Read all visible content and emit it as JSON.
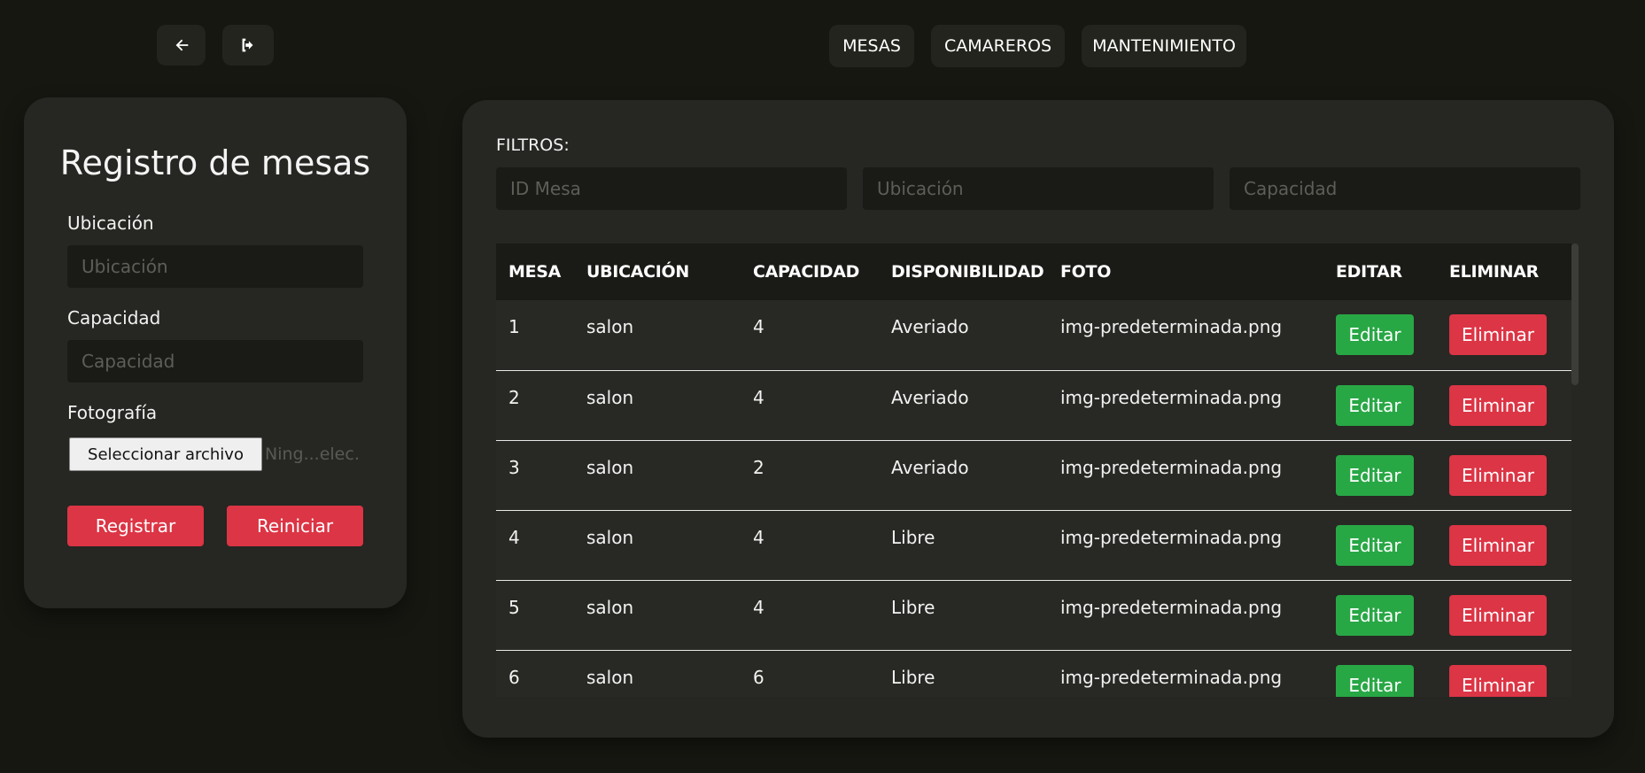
{
  "toolbar": {
    "back_icon": "arrow-left-icon",
    "logout_icon": "sign-out-icon"
  },
  "nav": {
    "items": [
      "MESAS",
      "CAMAREROS",
      "MANTENIMIENTO"
    ]
  },
  "form": {
    "title": "Registro de mesas",
    "ubicacion_label": "Ubicación",
    "ubicacion_placeholder": "Ubicación",
    "capacidad_label": "Capacidad",
    "capacidad_placeholder": "Capacidad",
    "foto_label": "Fotografía",
    "file_button": "Seleccionar archivo",
    "file_status": "Ning...elec.",
    "submit_label": "Registrar",
    "reset_label": "Reiniciar"
  },
  "filters": {
    "label": "FILTROS:",
    "id_placeholder": "ID Mesa",
    "ubicacion_placeholder": "Ubicación",
    "capacidad_placeholder": "Capacidad"
  },
  "table": {
    "columns": [
      "MESA",
      "UBICACIÓN",
      "CAPACIDAD",
      "DISPONIBILIDAD",
      "FOTO",
      "EDITAR",
      "ELIMINAR"
    ],
    "edit_label": "Editar",
    "delete_label": "Eliminar",
    "rows": [
      {
        "mesa": "1",
        "ubicacion": "salon",
        "capacidad": "4",
        "disponibilidad": "Averiado",
        "foto": "img-predeterminada.png"
      },
      {
        "mesa": "2",
        "ubicacion": "salon",
        "capacidad": "4",
        "disponibilidad": "Averiado",
        "foto": "img-predeterminada.png"
      },
      {
        "mesa": "3",
        "ubicacion": "salon",
        "capacidad": "2",
        "disponibilidad": "Averiado",
        "foto": "img-predeterminada.png"
      },
      {
        "mesa": "4",
        "ubicacion": "salon",
        "capacidad": "4",
        "disponibilidad": "Libre",
        "foto": "img-predeterminada.png"
      },
      {
        "mesa": "5",
        "ubicacion": "salon",
        "capacidad": "4",
        "disponibilidad": "Libre",
        "foto": "img-predeterminada.png"
      },
      {
        "mesa": "6",
        "ubicacion": "salon",
        "capacidad": "6",
        "disponibilidad": "Libre",
        "foto": "img-predeterminada.png"
      }
    ]
  },
  "colors": {
    "background": "#171712",
    "card": "#262622",
    "danger": "#dc3545",
    "success": "#28a745"
  }
}
